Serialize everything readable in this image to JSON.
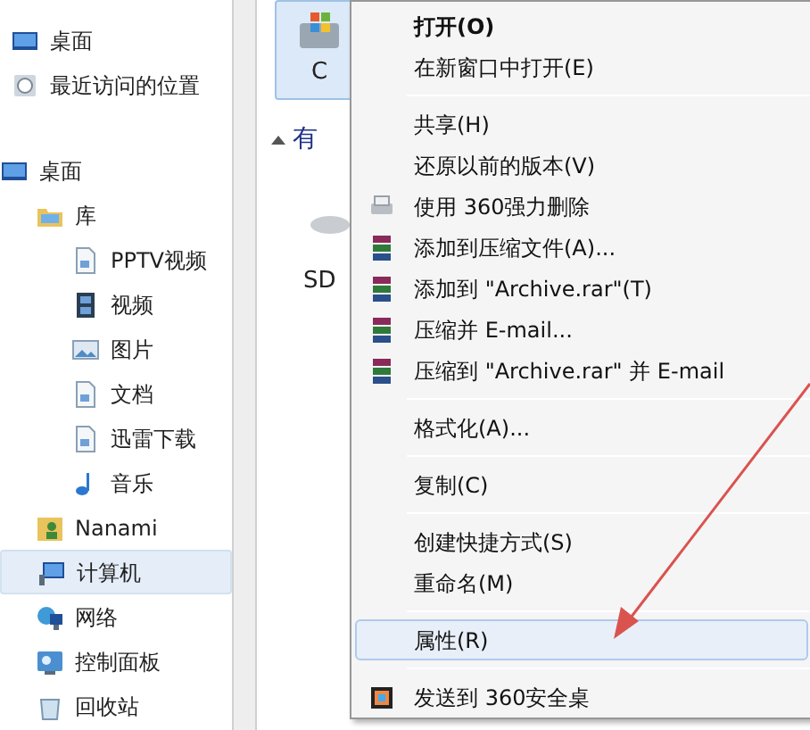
{
  "sidebar": {
    "favorites": [
      {
        "label": "桌面",
        "kind": "desktop"
      },
      {
        "label": "最近访问的位置",
        "kind": "recent"
      }
    ],
    "tree": [
      {
        "label": "桌面",
        "kind": "desktop",
        "selected": false,
        "children": [
          {
            "label": "库",
            "kind": "library",
            "selected": false,
            "children": [
              {
                "label": "PPTV视频",
                "kind": "document",
                "selected": false
              },
              {
                "label": "视频",
                "kind": "video",
                "selected": false
              },
              {
                "label": "图片",
                "kind": "picture",
                "selected": false
              },
              {
                "label": "文档",
                "kind": "document",
                "selected": false
              },
              {
                "label": "迅雷下载",
                "kind": "document",
                "selected": false
              },
              {
                "label": "音乐",
                "kind": "music",
                "selected": false
              }
            ]
          },
          {
            "label": "Nanami",
            "kind": "user",
            "selected": false
          },
          {
            "label": "计算机",
            "kind": "computer",
            "selected": true
          },
          {
            "label": "网络",
            "kind": "network",
            "selected": false
          },
          {
            "label": "控制面板",
            "kind": "control",
            "selected": false
          },
          {
            "label": "回收站",
            "kind": "recycle",
            "selected": false
          }
        ]
      }
    ]
  },
  "content": {
    "drive_label": "C",
    "group_header": "有",
    "device_label": "SD"
  },
  "context_menu": [
    {
      "kind": "item",
      "label": "打开(O)",
      "default": true,
      "selected": false
    },
    {
      "kind": "item",
      "label": "在新窗口中打开(E)",
      "default": false,
      "selected": false
    },
    {
      "kind": "separator"
    },
    {
      "kind": "item",
      "label": "共享(H)",
      "default": false,
      "selected": false
    },
    {
      "kind": "item",
      "label": "还原以前的版本(V)",
      "default": false,
      "selected": false
    },
    {
      "kind": "shredder",
      "label": "使用 360强力删除",
      "default": false,
      "selected": false
    },
    {
      "kind": "archive",
      "label": "添加到压缩文件(A)...",
      "default": false,
      "selected": false
    },
    {
      "kind": "archive",
      "label": "添加到 \"Archive.rar\"(T)",
      "default": false,
      "selected": false
    },
    {
      "kind": "archive",
      "label": "压缩并 E-mail...",
      "default": false,
      "selected": false
    },
    {
      "kind": "archive",
      "label": "压缩到 \"Archive.rar\" 并 E-mail",
      "default": false,
      "selected": false
    },
    {
      "kind": "separator"
    },
    {
      "kind": "item",
      "label": "格式化(A)...",
      "default": false,
      "selected": false
    },
    {
      "kind": "separator"
    },
    {
      "kind": "item",
      "label": "复制(C)",
      "default": false,
      "selected": false
    },
    {
      "kind": "separator"
    },
    {
      "kind": "item",
      "label": "创建快捷方式(S)",
      "default": false,
      "selected": false
    },
    {
      "kind": "item",
      "label": "重命名(M)",
      "default": false,
      "selected": false
    },
    {
      "kind": "separator"
    },
    {
      "kind": "item",
      "label": "属性(R)",
      "default": false,
      "selected": true
    },
    {
      "kind": "separator"
    },
    {
      "kind": "send",
      "label": "发送到 360安全桌",
      "default": false,
      "selected": false
    }
  ]
}
